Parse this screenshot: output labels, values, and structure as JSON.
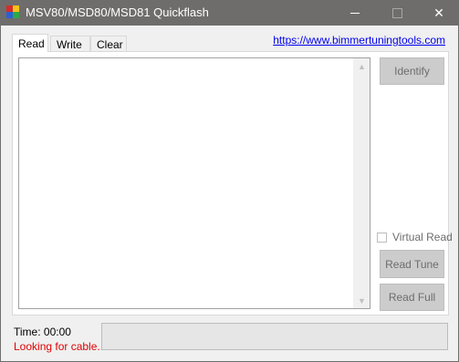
{
  "window": {
    "title": "MSV80/MSD80/MSD81 Quickflash",
    "icon": "app-icon",
    "controls": {
      "minimize": "minimize-icon",
      "maximize": "maximize-icon",
      "close": "close-icon"
    }
  },
  "tabs": [
    {
      "label": "Read",
      "active": true
    },
    {
      "label": "Write",
      "active": false
    },
    {
      "label": "Clear",
      "active": false
    }
  ],
  "link": {
    "text": "https://www.bimmertuningtools.com"
  },
  "log": {
    "text": ""
  },
  "buttons": {
    "identify": "Identify",
    "read_tune": "Read Tune",
    "read_full": "Read Full"
  },
  "virtual_read": {
    "label": "Virtual Read",
    "checked": false
  },
  "status": {
    "time": "Time: 00:00",
    "message": "Looking for cable..",
    "message_color": "#e00000"
  },
  "progress": {
    "value": 0
  }
}
